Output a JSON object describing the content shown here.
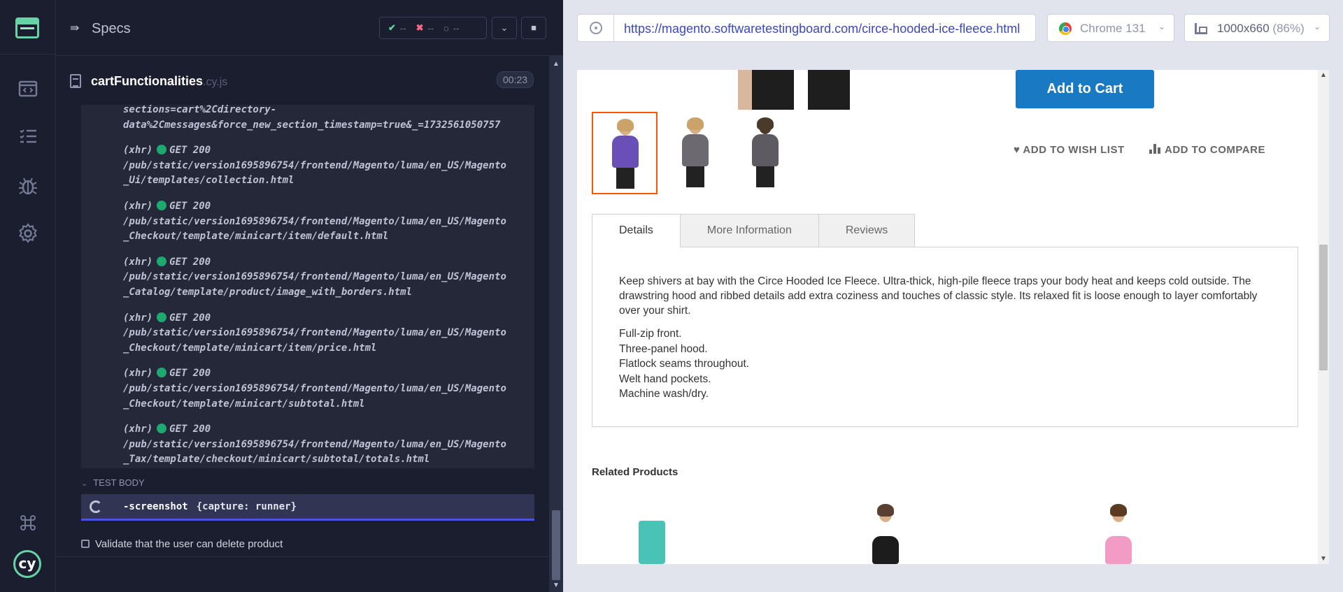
{
  "reporter": {
    "specs_label": "Specs",
    "stats": {
      "passed": "--",
      "failed": "--",
      "pending": "--"
    },
    "spec_name": "cartFunctionalities",
    "spec_ext": ".cy.js",
    "timer": "00:23",
    "log_lines": [
      {
        "text": "sections=cart%2Cdirectory-",
        "status": ""
      },
      {
        "text": "data%2Cmessages&force_new_section_timestamp=true&_=1732561050757",
        "status": ""
      },
      {
        "text": "(xhr)",
        "status": "GET 200"
      },
      {
        "text": "/pub/static/version1695896754/frontend/Magento/luma/en_US/Magento",
        "status": ""
      },
      {
        "text": "_Ui/templates/collection.html",
        "status": ""
      },
      {
        "text": "(xhr)",
        "status": "GET 200"
      },
      {
        "text": "/pub/static/version1695896754/frontend/Magento/luma/en_US/Magento",
        "status": ""
      },
      {
        "text": "_Checkout/template/minicart/item/default.html",
        "status": ""
      },
      {
        "text": "(xhr)",
        "status": "GET 200"
      },
      {
        "text": "/pub/static/version1695896754/frontend/Magento/luma/en_US/Magento",
        "status": ""
      },
      {
        "text": "_Catalog/template/product/image_with_borders.html",
        "status": ""
      },
      {
        "text": "(xhr)",
        "status": "GET 200"
      },
      {
        "text": "/pub/static/version1695896754/frontend/Magento/luma/en_US/Magento",
        "status": ""
      },
      {
        "text": "_Checkout/template/minicart/item/price.html",
        "status": ""
      },
      {
        "text": "(xhr)",
        "status": "GET 200"
      },
      {
        "text": "/pub/static/version1695896754/frontend/Magento/luma/en_US/Magento",
        "status": ""
      },
      {
        "text": "_Checkout/template/minicart/subtotal.html",
        "status": ""
      },
      {
        "text": "(xhr)",
        "status": "GET 200"
      },
      {
        "text": "/pub/static/version1695896754/frontend/Magento/luma/en_US/Magento",
        "status": ""
      },
      {
        "text": "_Tax/template/checkout/minicart/subtotal/totals.html",
        "status": ""
      }
    ],
    "test_body_label": "TEST BODY",
    "command": "-screenshot",
    "command_args": "{capture: runner}",
    "next_test": "Validate that the user can delete product"
  },
  "browser": {
    "url": "https://magento.softwaretestingboard.com/circe-hooded-ice-fleece.html",
    "browser_name": "Chrome 131",
    "viewport": "1000x660",
    "viewport_scale": "(86%)"
  },
  "product": {
    "add_to_cart": "Add to Cart",
    "add_to_wishlist": "ADD TO WISH LIST",
    "add_to_compare": "ADD TO COMPARE",
    "tabs": [
      "Details",
      "More Information",
      "Reviews"
    ],
    "description": "Keep shivers at bay with the Circe Hooded Ice Fleece. Ultra-thick, high-pile fleece traps your body heat and keeps cold outside. The drawstring hood and ribbed details add extra coziness and touches of classic style. Its relaxed fit is loose enough to layer comfortably over your shirt.",
    "features": [
      "Full-zip front.",
      "Three-panel hood.",
      "Flatlock seams throughout.",
      "Welt hand pockets.",
      "Machine wash/dry."
    ],
    "related_title": "Related Products",
    "thumb_colors": [
      "#6a4fb8",
      "#6c6a70",
      "#5d5a62"
    ],
    "related_colors": [
      "#49c3b5",
      "#1c1c1c",
      "#f29bc4"
    ]
  }
}
